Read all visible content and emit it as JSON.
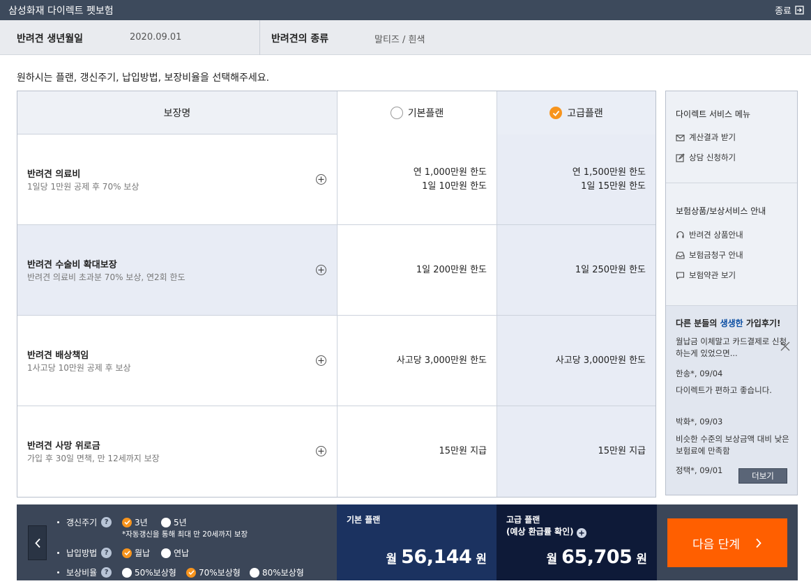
{
  "window": {
    "title": "삼성화재 다이렉트 펫보험",
    "close_label": "종료"
  },
  "pet": {
    "birth_label": "반려견 생년월일",
    "birth_value": "2020.09.01",
    "breed_label": "반려견의 종류",
    "breed_value": "말티즈 / 흰색"
  },
  "instruction": "원하시는 플랜, 갱신주기, 납입방법, 보장비율을 선택해주세요.",
  "table": {
    "header_name": "보장명",
    "header_basic": "기본플랜",
    "header_premium": "고급플랜",
    "selected_plan": "premium",
    "rows": [
      {
        "title": "반려견 의료비",
        "sub": "1일당 1만원 공제 후 70% 보상",
        "basic": [
          "연 1,000만원 한도",
          "1일 10만원 한도"
        ],
        "premium": [
          "연 1,500만원 한도",
          "1일 15만원 한도"
        ]
      },
      {
        "title": "반려견 수술비 확대보장",
        "sub": "반려견 의료비 초과분 70% 보상, 연2회 한도",
        "basic": [
          "1일 200만원 한도"
        ],
        "premium": [
          "1일 250만원 한도"
        ]
      },
      {
        "title": "반려견 배상책임",
        "sub": "1사고당 10만원 공제 후 보상",
        "basic": [
          "사고당 3,000만원 한도"
        ],
        "premium": [
          "사고당 3,000만원 한도"
        ]
      },
      {
        "title": "반려견 사망 위로금",
        "sub": "가입 후 30일 면책, 만 12세까지 보장",
        "basic": [
          "15만원 지급"
        ],
        "premium": [
          "15만원 지급"
        ]
      }
    ]
  },
  "side": {
    "menu_title": "다이렉트 서비스 메뉴",
    "menu_items": [
      {
        "label": "계산결과 받기",
        "icon": "mail-icon"
      },
      {
        "label": "상담 신청하기",
        "icon": "edit-icon"
      }
    ],
    "guide_title": "보험상품/보상서비스 안내",
    "guide_items": [
      {
        "label": "반려견 상품안내",
        "icon": "headset-icon"
      },
      {
        "label": "보험금청구 안내",
        "icon": "inbox-icon"
      },
      {
        "label": "보험약관 보기",
        "icon": "chat-icon"
      }
    ],
    "review_title_pre": "다른 분들의 ",
    "review_title_hl": "생생한",
    "review_title_post": " 가입후기!",
    "reviews": [
      {
        "text": "월납금 이체말고 카드결제로 신청하는게 있었으면...",
        "author": "한송*, 09/04"
      },
      {
        "text": "다이렉트가 편하고 좋습니다.",
        "author": "박화*, 09/03"
      },
      {
        "text": "비슷한 수준의 보상금액 대비 낮은 보험료에 만족함",
        "author": "정택*, 09/01"
      }
    ],
    "more_label": "더보기"
  },
  "options": {
    "renewal": {
      "label": "갱신주기",
      "choices": [
        "3년",
        "5년"
      ],
      "selected": "3년",
      "note": "*자동갱신을 통해 최대 만 20세까지 보장"
    },
    "payment": {
      "label": "납입방법",
      "choices": [
        "월납",
        "연납"
      ],
      "selected": "월납"
    },
    "ratio": {
      "label": "보상비율",
      "choices": [
        "50%보상형",
        "70%보상형",
        "80%보상형"
      ],
      "selected": "70%보상형"
    },
    "help_glyph": "?"
  },
  "price": {
    "basic_label": "기본 플랜",
    "basic_unit": "월",
    "basic_value": "56,144",
    "basic_currency": "원",
    "premium_label_1": "고급 플랜",
    "premium_label_2": "(예상 환급률 확인)",
    "premium_unit": "월",
    "premium_value": "65,705",
    "premium_currency": "원"
  },
  "next_label": "다음 단계",
  "colors": {
    "accent": "#f7941d",
    "next": "#ff5f00",
    "navy": "#1b3260",
    "dark_navy": "#0e1a38",
    "bar": "#3b4658"
  }
}
